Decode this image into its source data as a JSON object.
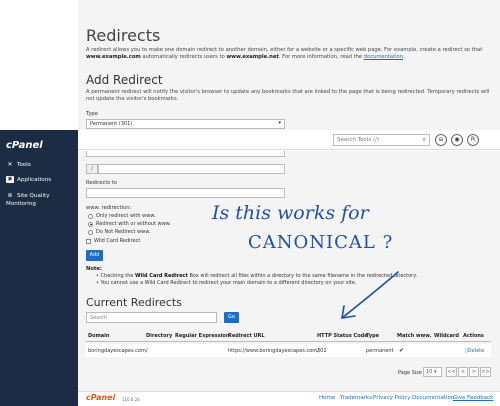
{
  "top": {
    "title": "Redirects",
    "intro_a": "A redirect allows you to make one domain redirect to another domain, either for a website or a specific web page. For example, create a redirect so that ",
    "intro_b": "www.example.com",
    "intro_c": " automatically redirects users to ",
    "intro_d": "www.example.net",
    "intro_e": ". For more information, read the ",
    "intro_link": "documentation",
    "intro_f": ".",
    "add_title": "Add Redirect",
    "add_desc": "A permanent redirect will notify the visitor's browser to update any bookmarks that are linked to the page that is being redirected. Temporary redirects will not update the visitor's bookmarks.",
    "type_label": "Type",
    "type_value": "Permanent (301)"
  },
  "sidebar": {
    "logo": "cPanel",
    "items": [
      {
        "label": "Tools"
      },
      {
        "label": "Applications"
      },
      {
        "label": "Site Quality"
      }
    ],
    "monitoring": "Monitoring"
  },
  "header": {
    "search_placeholder": "Search Tools (/)",
    "user_initial": "R"
  },
  "form": {
    "slash": "/",
    "redirects_to_label": "Redirects to",
    "www_label": "www. redirection:",
    "radio_options": [
      {
        "label": "Only redirect with www.",
        "checked": false
      },
      {
        "label": "Redirect with or without www.",
        "checked": true
      },
      {
        "label": "Do Not Redirect www.",
        "checked": false
      }
    ],
    "wildcard_label": "Wild Card Redirect",
    "add_button": "Add",
    "note_title": "Note:",
    "note1_a": "Checking the ",
    "note1_b": "Wild Card Redirect",
    "note1_c": " Box will redirect all files within a directory to the same filename in the redirected directory.",
    "note2": "You cannot use a Wild Card Redirect to redirect your main domain to a different directory on your site."
  },
  "current": {
    "title": "Current Redirects",
    "search_placeholder": "Search",
    "go_button": "Go",
    "columns": [
      "Domain",
      "Directory",
      "Regular Expression",
      "Redirect URL",
      "HTTP Status Code",
      "Type",
      "Match www.",
      "Wildcard",
      "Actions"
    ],
    "row": {
      "domain": "boringdayescapes.com",
      "directory": "/",
      "regex": "",
      "url": "https://www.boringdayescapes.com/",
      "status": "301",
      "type": "permanent",
      "match_www": "✔",
      "wildcard": "",
      "action": "Delete"
    },
    "page_size_label": "Page Size",
    "page_size": "10",
    "pager": [
      "<<",
      "<",
      ">",
      ">>"
    ]
  },
  "footer": {
    "logo": "cPanel",
    "version": "110.0.24",
    "links": [
      "Home",
      "Trademarks",
      "Privacy Policy",
      "Documentation",
      "Give Feedback"
    ]
  },
  "handwriting": {
    "line1": "Is this works for",
    "line2": "CANONICAL ?"
  }
}
